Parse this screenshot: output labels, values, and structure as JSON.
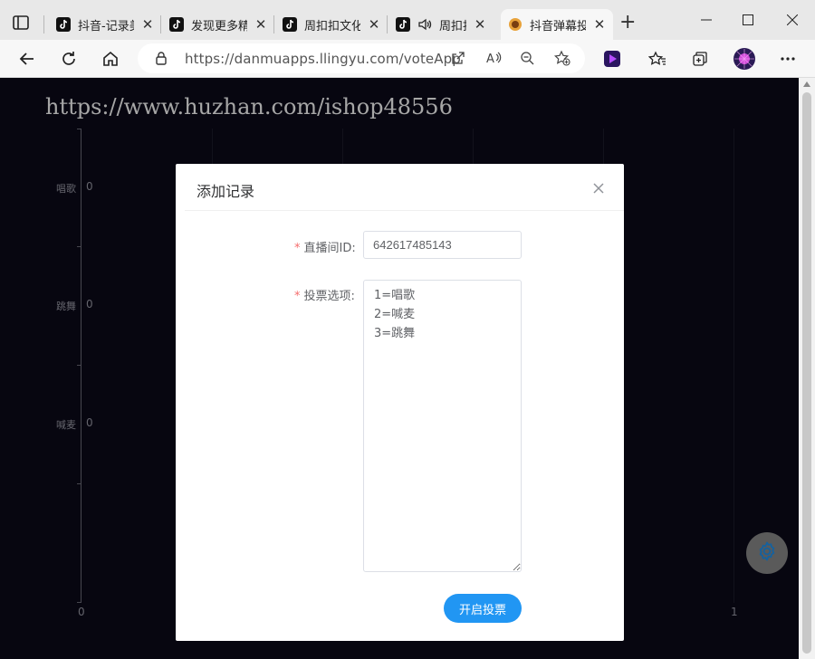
{
  "browser": {
    "tabs": [
      {
        "title": "抖音-记录美好生活",
        "icon": "tiktok-icon"
      },
      {
        "title": "发现更多精彩视频",
        "icon": "tiktok-icon"
      },
      {
        "title": "周扣扣文化传媒",
        "icon": "tiktok-icon"
      },
      {
        "title": "周扣扣的直播间",
        "icon": "tiktok-icon",
        "audio": "speaker-icon"
      },
      {
        "title": "抖音弹幕投票",
        "icon": "site-icon",
        "active": true
      }
    ],
    "url": "https://danmuapps.llingyu.com/voteApp"
  },
  "page": {
    "watermark": "https://www.huzhan.com/ishop48556"
  },
  "chart_data": {
    "type": "bar",
    "orientation": "horizontal",
    "categories": [
      "唱歌",
      "跳舞",
      "喊麦"
    ],
    "values": [
      0,
      0,
      0
    ],
    "x_tick_labels": [
      "0",
      "1"
    ],
    "xlim": [
      0,
      1
    ],
    "grid": true
  },
  "dialog": {
    "title": "添加记录",
    "room_id_label": "直播间ID:",
    "room_id_value": "642617485143",
    "options_label": "投票选项:",
    "options_value": "1=唱歌\n2=喊麦\n3=跳舞",
    "submit_label": "开启投票",
    "required_mark": "*"
  },
  "colors": {
    "page_bg": "#0b0a1a",
    "primary_button": "#2196f3",
    "required": "#f56c6c",
    "gear_button": "#8a8a8a",
    "gear_icon": "#2196f3"
  }
}
